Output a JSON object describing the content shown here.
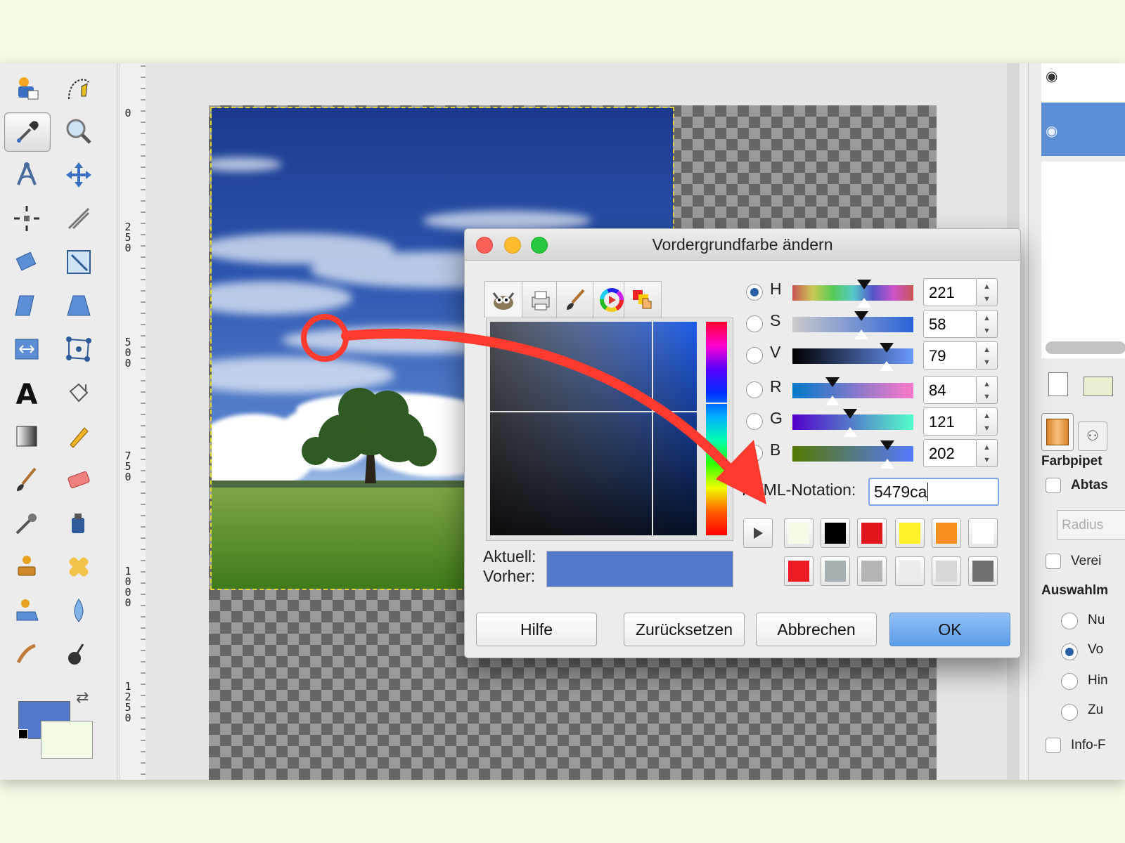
{
  "dialog": {
    "title": "Vordergrundfarbe ändern",
    "channels": [
      {
        "label": "H",
        "value": "221",
        "selected": true
      },
      {
        "label": "S",
        "value": "58",
        "selected": false
      },
      {
        "label": "V",
        "value": "79",
        "selected": false
      },
      {
        "label": "R",
        "value": "84",
        "selected": false
      },
      {
        "label": "G",
        "value": "121",
        "selected": false
      },
      {
        "label": "B",
        "value": "202",
        "selected": false
      }
    ],
    "html_label": "HTML-Notation:",
    "html_value": "5479ca",
    "current_label": "Aktuell:",
    "previous_label": "Vorher:",
    "current_color": "#5479ca",
    "history_swatches": [
      "#f1fbe6",
      "#000000",
      "#e2141c",
      "#fff02a",
      "#f7901e",
      "#ffffff"
    ],
    "extra_swatches": [
      "#ee1b24",
      "#a7b0b3",
      "#b4b4b4",
      "#ececec",
      "#d7d7d7",
      "#707070"
    ],
    "buttons": {
      "help": "Hilfe",
      "reset": "Zurücksetzen",
      "cancel": "Abbrechen",
      "ok": "OK"
    }
  },
  "ruler": {
    "labels": [
      "0",
      "2\n5\n0",
      "5\n0\n0",
      "7\n5\n0",
      "1\n0\n0\n0",
      "1\n2\n5\n0"
    ]
  },
  "toolbox": {
    "foreground": "#5479ca",
    "background": "#f1fbe6"
  },
  "dock": {
    "tool_title": "Farbpipet",
    "sample_label": "Abtas",
    "radius_placeholder": "Radius",
    "merge_label": "Verei",
    "section_title": "Auswahlm",
    "options": [
      "Nu",
      "Vo",
      "Hin",
      "Zu"
    ],
    "info_label": "Info-F"
  },
  "annotation": {
    "color": "#ff3b30"
  }
}
